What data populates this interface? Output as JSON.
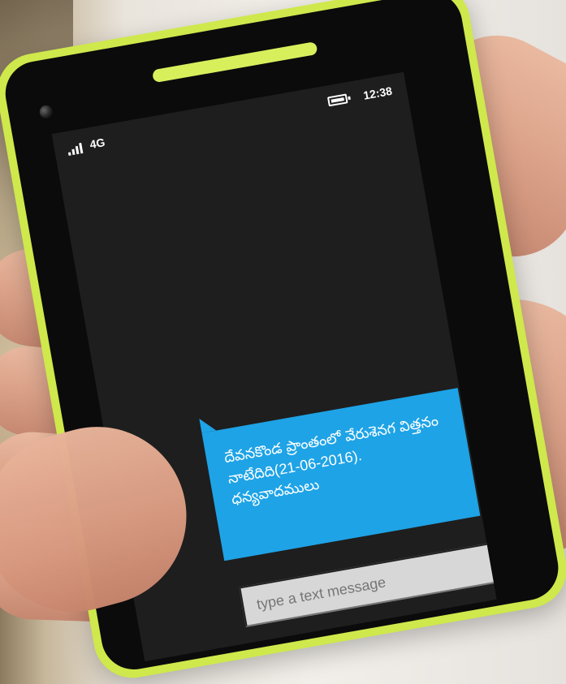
{
  "status": {
    "network": "4G",
    "time": "12:38",
    "icons": [
      "signal-icon",
      "battery-icon"
    ]
  },
  "message": {
    "text": "దేవనకొండ ప్రాంతంలో వేరుశెనగ విత్తనం నాటేదిది(21-06-2016). ధన్యవాదములు"
  },
  "input": {
    "placeholder": "type a text message"
  },
  "colors": {
    "phone_frame": "#cfe84c",
    "screen": "#1e1e1e",
    "bubble": "#1ea3e6",
    "input": "#d7d7d7"
  }
}
